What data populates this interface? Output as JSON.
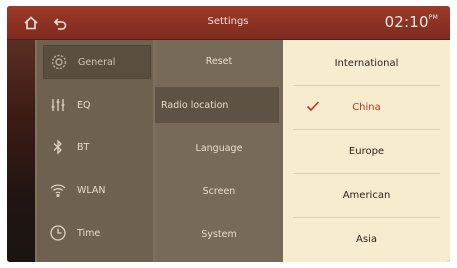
{
  "header": {
    "title": "Settings",
    "time": "02:10",
    "ampm": "PM",
    "home_icon": "home-icon",
    "back_icon": "back-icon"
  },
  "sidebar": {
    "items": [
      {
        "label": "General",
        "icon": "gear-icon",
        "active": true
      },
      {
        "label": "EQ",
        "icon": "equalizer-icon",
        "active": false
      },
      {
        "label": "BT",
        "icon": "bluetooth-icon",
        "active": false
      },
      {
        "label": "WLAN",
        "icon": "wifi-icon",
        "active": false
      },
      {
        "label": "Time",
        "icon": "clock-icon",
        "active": false
      }
    ]
  },
  "submenu": {
    "items": [
      {
        "label": "Reset",
        "active": false
      },
      {
        "label": "Radio location",
        "active": true
      },
      {
        "label": "Language",
        "active": false
      },
      {
        "label": "Screen",
        "active": false
      },
      {
        "label": "System",
        "active": false
      }
    ]
  },
  "options": {
    "items": [
      {
        "label": "International",
        "selected": false
      },
      {
        "label": "China",
        "selected": true
      },
      {
        "label": "Europe",
        "selected": false
      },
      {
        "label": "American",
        "selected": false
      },
      {
        "label": "Asia",
        "selected": false
      }
    ],
    "check_icon": "checkmark-icon"
  },
  "colors": {
    "topbar": "#8f3426",
    "panel_options": "#f7ecd0",
    "selected_text": "#c4331c"
  }
}
